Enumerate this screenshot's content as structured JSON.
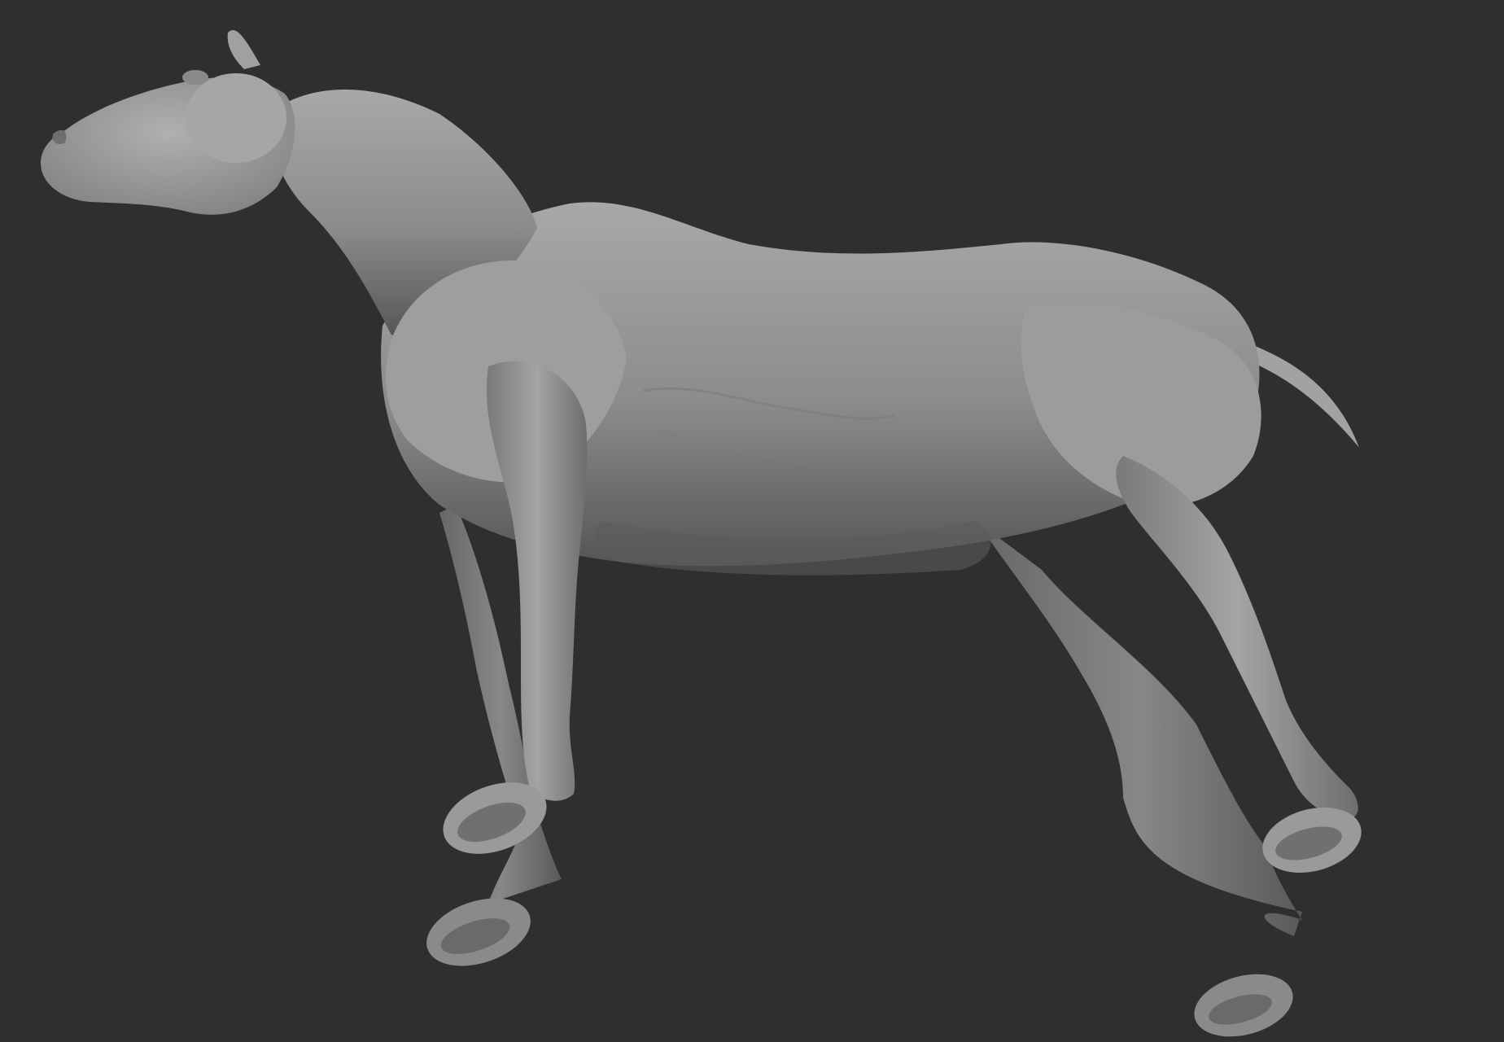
{
  "scene": {
    "background_color": "#2f2f2f",
    "subject": "horse-sculpt",
    "material_color": "#9a9a9a"
  }
}
